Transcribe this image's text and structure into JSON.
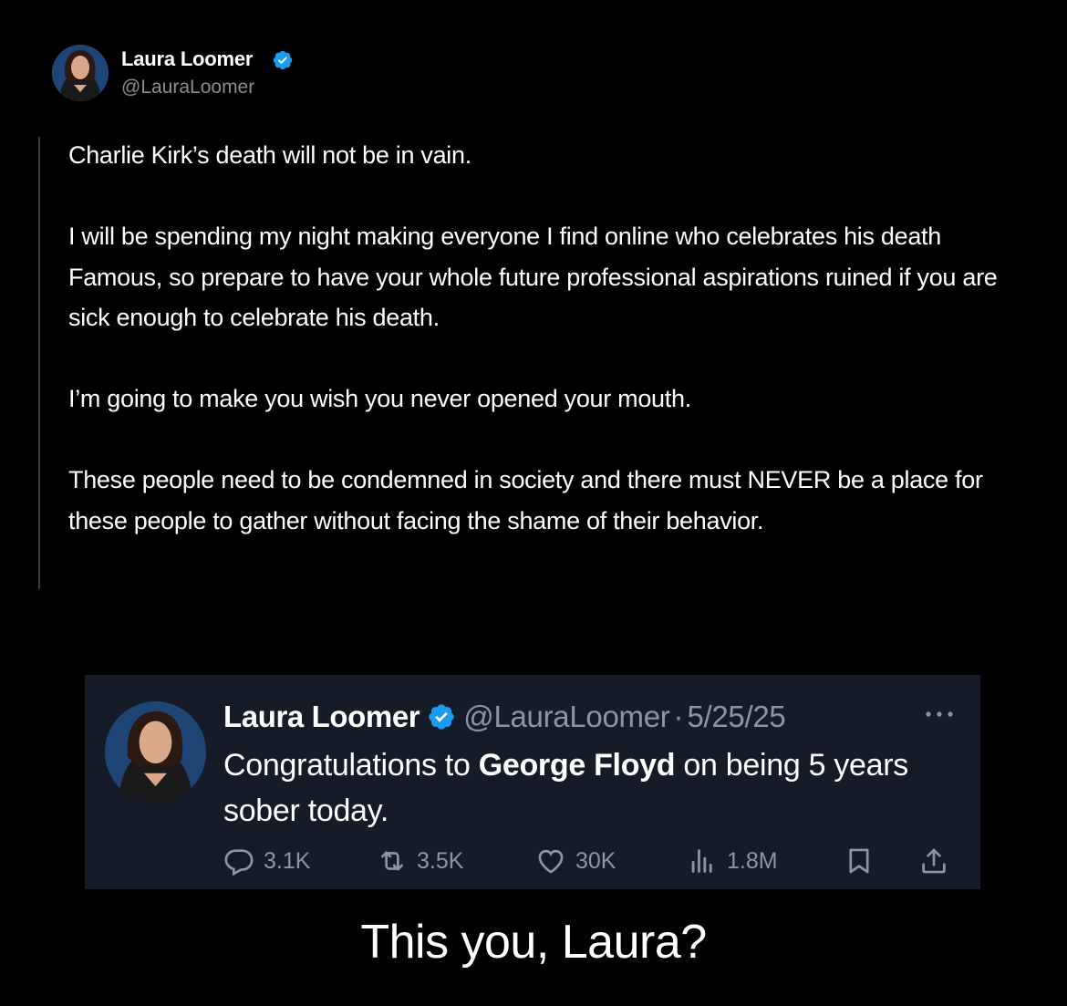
{
  "post": {
    "author_name": "Laura Loomer",
    "author_handle": "@LauraLoomer",
    "paragraphs": [
      "Charlie Kirk’s death will not be in vain.",
      "I will be spending my night making everyone I find online who celebrates his death Famous, so prepare to have your whole future professional aspirations ruined if you are sick enough to celebrate his death.",
      "I’m going to make you wish you never opened your mouth.",
      "These people need to be condemned in society and there must NEVER be a place for these people to gather without facing the shame of their behavior."
    ]
  },
  "quoted_tweet": {
    "author_name": "Laura Loomer",
    "author_handle": "@LauraLoomer",
    "separator": "·",
    "date": "5/25/25",
    "text_before": "Congratulations to ",
    "text_bold": "George Floyd",
    "text_after": " on being 5 years sober today.",
    "stats": {
      "replies": "3.1K",
      "reposts": "3.5K",
      "likes": "30K",
      "views": "1.8M"
    }
  },
  "caption": "This you, Laura?",
  "colors": {
    "background": "#000000",
    "card_background": "#151c28",
    "verified_blue": "#1d9bf0",
    "muted_text": "#8b96a3"
  },
  "icons": {
    "verified": "verified-badge-icon",
    "reply": "reply-icon",
    "repost": "repost-icon",
    "like": "heart-icon",
    "views": "views-icon",
    "bookmark": "bookmark-icon",
    "share": "share-icon",
    "more": "more-icon"
  }
}
